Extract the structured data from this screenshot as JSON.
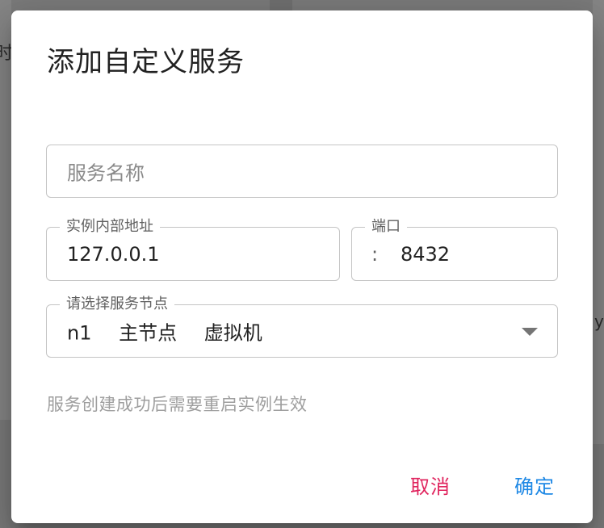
{
  "background": {
    "fragment_text_left": "时",
    "fragment_text_right": "yn"
  },
  "dialog": {
    "title": "添加自定义服务",
    "service_name": {
      "placeholder": "服务名称",
      "value": ""
    },
    "instance_address": {
      "label": "实例内部地址",
      "value": "127.0.0.1"
    },
    "port": {
      "label": "端口",
      "separator": ":",
      "value": "8432"
    },
    "node_select": {
      "label": "请选择服务节点",
      "selected": {
        "id": "n1",
        "role": "主节点",
        "type": "虚拟机"
      }
    },
    "hint": "服务创建成功后需要重启实例生效",
    "cancel_label": "取消",
    "confirm_label": "确定"
  },
  "colors": {
    "cancel": "#e0245e",
    "confirm": "#1e88e5",
    "overlay": "#7a7a7a"
  }
}
